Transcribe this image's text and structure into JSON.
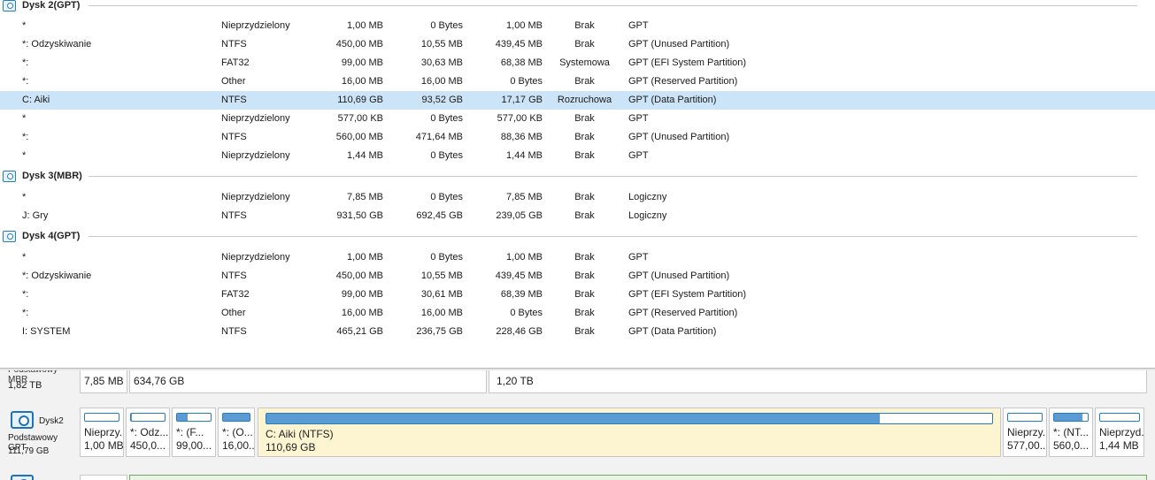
{
  "disks": [
    {
      "title": "Dysk 2(GPT)",
      "rows": [
        {
          "name": "*",
          "fs": "Nieprzydzielony",
          "capacity": "1,00 MB",
          "used": "0 Bytes",
          "free": "1,00 MB",
          "flag": "Brak",
          "type": "GPT"
        },
        {
          "name": "*: Odzyskiwanie",
          "fs": "NTFS",
          "capacity": "450,00 MB",
          "used": "10,55 MB",
          "free": "439,45 MB",
          "flag": "Brak",
          "type": "GPT (Unused Partition)"
        },
        {
          "name": "*:",
          "fs": "FAT32",
          "capacity": "99,00 MB",
          "used": "30,63 MB",
          "free": "68,38 MB",
          "flag": "Systemowa",
          "type": "GPT (EFI System Partition)"
        },
        {
          "name": "*:",
          "fs": "Other",
          "capacity": "16,00 MB",
          "used": "16,00 MB",
          "free": "0 Bytes",
          "flag": "Brak",
          "type": "GPT (Reserved Partition)"
        },
        {
          "name": "C: Aiki",
          "fs": "NTFS",
          "capacity": "110,69 GB",
          "used": "93,52 GB",
          "free": "17,17 GB",
          "flag": "Rozruchowa",
          "type": "GPT (Data Partition)"
        },
        {
          "name": "*",
          "fs": "Nieprzydzielony",
          "capacity": "577,00 KB",
          "used": "0 Bytes",
          "free": "577,00 KB",
          "flag": "Brak",
          "type": "GPT"
        },
        {
          "name": "*:",
          "fs": "NTFS",
          "capacity": "560,00 MB",
          "used": "471,64 MB",
          "free": "88,36 MB",
          "flag": "Brak",
          "type": "GPT (Unused Partition)"
        },
        {
          "name": "*",
          "fs": "Nieprzydzielony",
          "capacity": "1,44 MB",
          "used": "0 Bytes",
          "free": "1,44 MB",
          "flag": "Brak",
          "type": "GPT"
        }
      ]
    },
    {
      "title": "Dysk 3(MBR)",
      "rows": [
        {
          "name": "*",
          "fs": "Nieprzydzielony",
          "capacity": "7,85 MB",
          "used": "0 Bytes",
          "free": "7,85 MB",
          "flag": "Brak",
          "type": "Logiczny"
        },
        {
          "name": "J: Gry",
          "fs": "NTFS",
          "capacity": "931,50 GB",
          "used": "692,45 GB",
          "free": "239,05 GB",
          "flag": "Brak",
          "type": "Logiczny"
        }
      ]
    },
    {
      "title": "Dysk 4(GPT)",
      "rows": [
        {
          "name": "*",
          "fs": "Nieprzydzielony",
          "capacity": "1,00 MB",
          "used": "0 Bytes",
          "free": "1,00 MB",
          "flag": "Brak",
          "type": "GPT"
        },
        {
          "name": "*: Odzyskiwanie",
          "fs": "NTFS",
          "capacity": "450,00 MB",
          "used": "10,55 MB",
          "free": "439,45 MB",
          "flag": "Brak",
          "type": "GPT (Unused Partition)"
        },
        {
          "name": "*:",
          "fs": "FAT32",
          "capacity": "99,00 MB",
          "used": "30,61 MB",
          "free": "68,39 MB",
          "flag": "Brak",
          "type": "GPT (EFI System Partition)"
        },
        {
          "name": "*:",
          "fs": "Other",
          "capacity": "16,00 MB",
          "used": "16,00 MB",
          "free": "0 Bytes",
          "flag": "Brak",
          "type": "GPT (Reserved Partition)"
        },
        {
          "name": "I: SYSTEM",
          "fs": "NTFS",
          "capacity": "465,21 GB",
          "used": "236,75 GB",
          "free": "228,46 GB",
          "flag": "Brak",
          "type": "GPT (Data Partition)"
        }
      ]
    }
  ],
  "selected_row": "C: Aiki",
  "map": {
    "top_disk": {
      "cut_label": "Podstawowy MBR",
      "size": "1,82 TB",
      "partitions": [
        {
          "size": "7,85 MB"
        },
        {
          "size": "634,76 GB"
        },
        {
          "size": "1,20 TB"
        }
      ]
    },
    "disk2": {
      "name": "Dysk2",
      "kind": "Podstawowy GPT",
      "size": "111,79 GB",
      "partitions": [
        {
          "label": "Nieprzy...",
          "size": "1,00 MB",
          "used_fraction": 0.0
        },
        {
          "label": "*: Odz...",
          "size": "450,0...",
          "used_fraction": 0.02
        },
        {
          "label": "*: (F...",
          "size": "99,00...",
          "used_fraction": 0.31
        },
        {
          "label": "*: (O...",
          "size": "16,00...",
          "used_fraction": 1.0
        },
        {
          "label": "C: Aiki (NTFS)",
          "size": "110,69 GB",
          "used_fraction": 0.845
        },
        {
          "label": "Nieprzy...",
          "size": "577,00...",
          "used_fraction": 0.0
        },
        {
          "label": "*: (NT...",
          "size": "560,0...",
          "used_fraction": 0.84
        },
        {
          "label": "Nieprzyd...",
          "size": "1,44 MB",
          "used_fraction": 0.0
        }
      ]
    }
  },
  "colors": {
    "selection": "#cce4f7",
    "accent": "#2a7bb9",
    "fill": "#5b9bd5",
    "active_partition": "#fdf4d2"
  }
}
